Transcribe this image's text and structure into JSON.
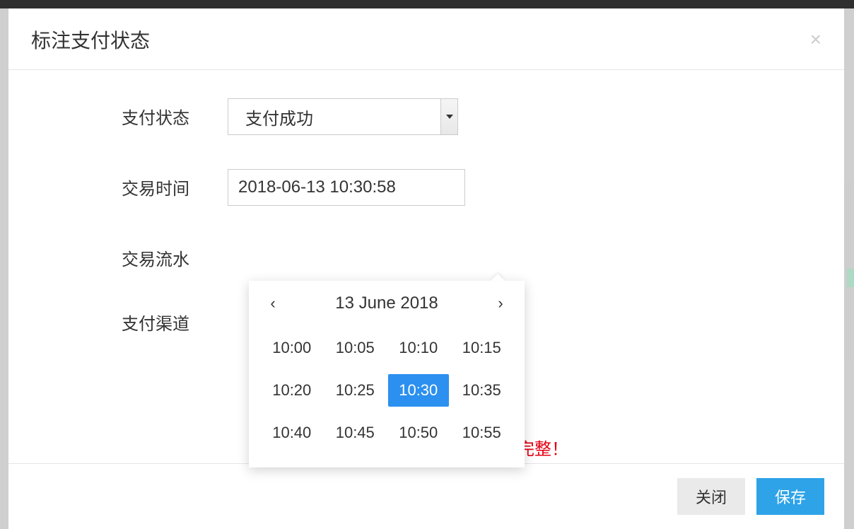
{
  "modal": {
    "title": "标注支付状态",
    "closeGlyph": "×"
  },
  "form": {
    "paymentStatus": {
      "label": "支付状态",
      "value": "支付成功"
    },
    "transactionTime": {
      "label": "交易时间",
      "value": "2018-06-13 10:30:58"
    },
    "transactionSerial": {
      "label": "交易流水"
    },
    "paymentChannel": {
      "label": "支付渠道"
    }
  },
  "datepicker": {
    "prevGlyph": "‹",
    "nextGlyph": "›",
    "title": "13 June 2018",
    "selected": "10:30",
    "times": [
      "10:00",
      "10:05",
      "10:10",
      "10:15",
      "10:20",
      "10:25",
      "10:30",
      "10:35",
      "10:40",
      "10:45",
      "10:50",
      "10:55"
    ]
  },
  "warning": "完整！",
  "footer": {
    "close": "关闭",
    "save": "保存"
  }
}
